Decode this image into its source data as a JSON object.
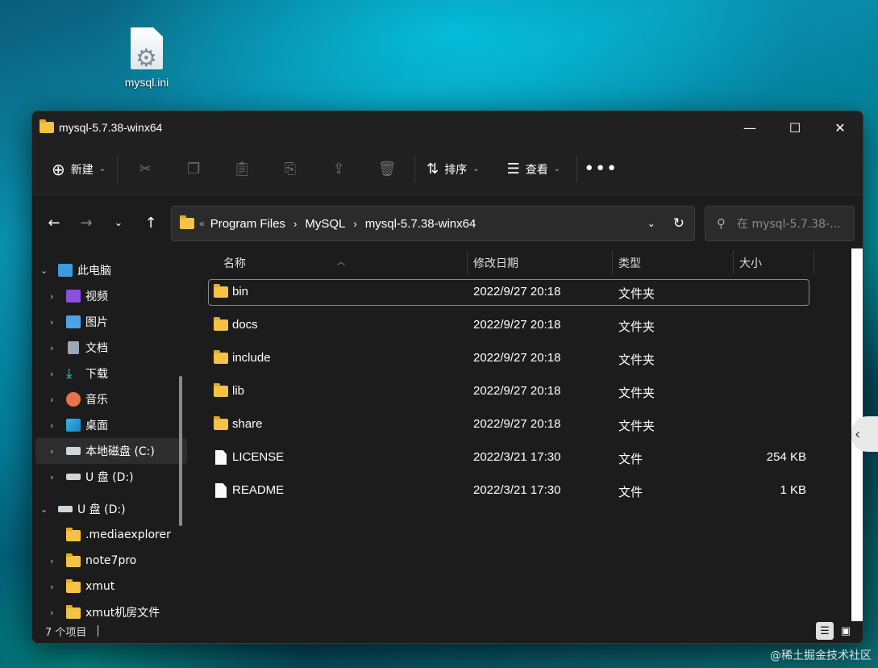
{
  "desktop": {
    "icon_label": "mysql.ini",
    "watermark": "@稀土掘金技术社区"
  },
  "window": {
    "title": "mysql-5.7.38-winx64",
    "controls": {
      "minimize": "—",
      "maximize": "☐",
      "close": "✕"
    }
  },
  "toolbar": {
    "new_label": "新建",
    "sort_label": "排序",
    "view_label": "查看",
    "more_label": "•••"
  },
  "address": {
    "overflow": "«",
    "crumbs": [
      "Program Files",
      "MySQL",
      "mysql-5.7.38-winx64"
    ],
    "search_placeholder": "在 mysql-5.7.38-..."
  },
  "sidebar": {
    "items": [
      {
        "label": "此电脑",
        "icon": "monitor-icon"
      },
      {
        "label": "视频",
        "icon": "video-icon"
      },
      {
        "label": "图片",
        "icon": "picture-icon"
      },
      {
        "label": "文档",
        "icon": "document-icon"
      },
      {
        "label": "下载",
        "icon": "download-icon"
      },
      {
        "label": "音乐",
        "icon": "music-icon"
      },
      {
        "label": "桌面",
        "icon": "desktop-icon"
      },
      {
        "label": "本地磁盘 (C:)",
        "icon": "drive-icon"
      },
      {
        "label": "U 盘 (D:)",
        "icon": "usb-drive-icon"
      },
      {
        "label": "U 盘 (D:)",
        "icon": "usb-drive-icon"
      },
      {
        "label": ".mediaexplorer",
        "icon": "folder-icon"
      },
      {
        "label": "note7pro",
        "icon": "folder-icon"
      },
      {
        "label": "xmut",
        "icon": "folder-icon"
      },
      {
        "label": "xmut机房文件",
        "icon": "folder-icon"
      }
    ]
  },
  "columns": {
    "name": "名称",
    "modified": "修改日期",
    "type": "类型",
    "size": "大小"
  },
  "files": [
    {
      "name": "bin",
      "modified": "2022/9/27 20:18",
      "type": "文件夹",
      "size": ""
    },
    {
      "name": "docs",
      "modified": "2022/9/27 20:18",
      "type": "文件夹",
      "size": ""
    },
    {
      "name": "include",
      "modified": "2022/9/27 20:18",
      "type": "文件夹",
      "size": ""
    },
    {
      "name": "lib",
      "modified": "2022/9/27 20:18",
      "type": "文件夹",
      "size": ""
    },
    {
      "name": "share",
      "modified": "2022/9/27 20:18",
      "type": "文件夹",
      "size": ""
    },
    {
      "name": "LICENSE",
      "modified": "2022/3/21 17:30",
      "type": "文件",
      "size": "254 KB"
    },
    {
      "name": "README",
      "modified": "2022/3/21 17:30",
      "type": "文件",
      "size": "1 KB"
    }
  ],
  "status": {
    "count": "7 个项目"
  }
}
